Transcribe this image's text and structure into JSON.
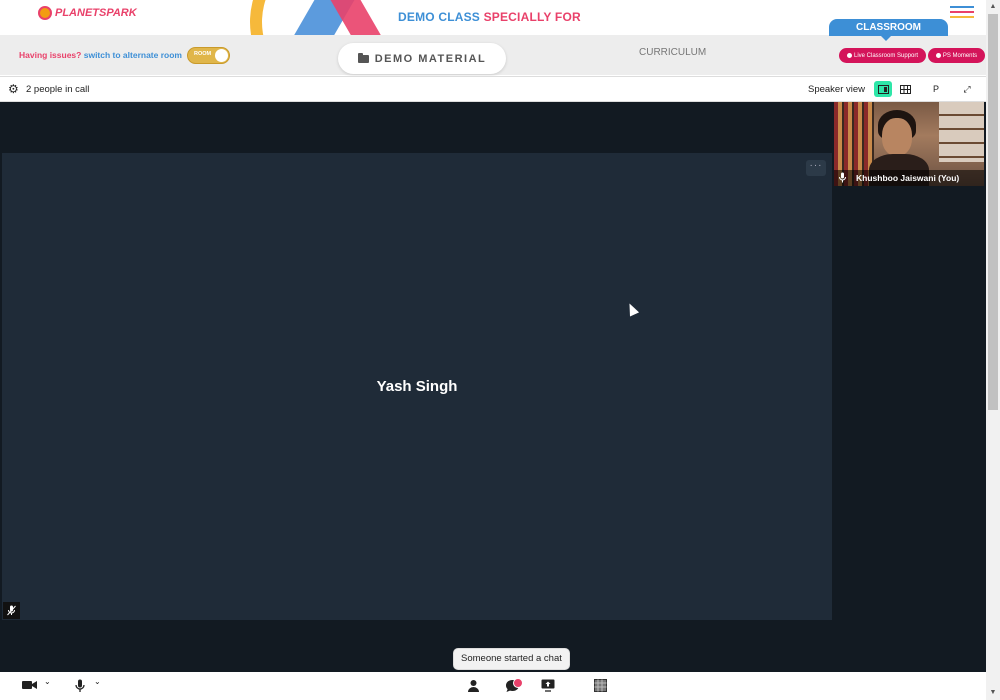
{
  "header": {
    "logo_text": "PLANETSPARK",
    "title_part1": "DEMO CLASS",
    "title_part2": "SPECIALLY FOR",
    "menu_icon": "hamburger-icon",
    "menu_colors": [
      "#3d8fd6",
      "#e9416a",
      "#f6b93b"
    ]
  },
  "subbar": {
    "issues_text": "Having issues?",
    "switch_text": "switch to alternate room",
    "toggle_label": "ROOM",
    "demo_material": "DEMO MATERIAL",
    "curriculum": "CURRICULUM",
    "classroom_tab": "CLASSROOM",
    "live_support": "Live Classroom Support",
    "ps_moments": "PS Moments"
  },
  "call": {
    "people_count": "2 people in call",
    "speaker_view": "Speaker view",
    "p_button": "P"
  },
  "stage": {
    "main_participant": "Yash Singh",
    "more_icon": "more-horizontal-icon",
    "self_name": "Khushboo Jaiswani (You)"
  },
  "toolbar": {
    "toast": "Someone started a chat"
  },
  "colors": {
    "brand_pink": "#e9416a",
    "brand_blue": "#3d8fd6",
    "tile_bg": "#1f2b38",
    "stage_bg": "#121a22",
    "active_view": "#2ee6a8"
  }
}
